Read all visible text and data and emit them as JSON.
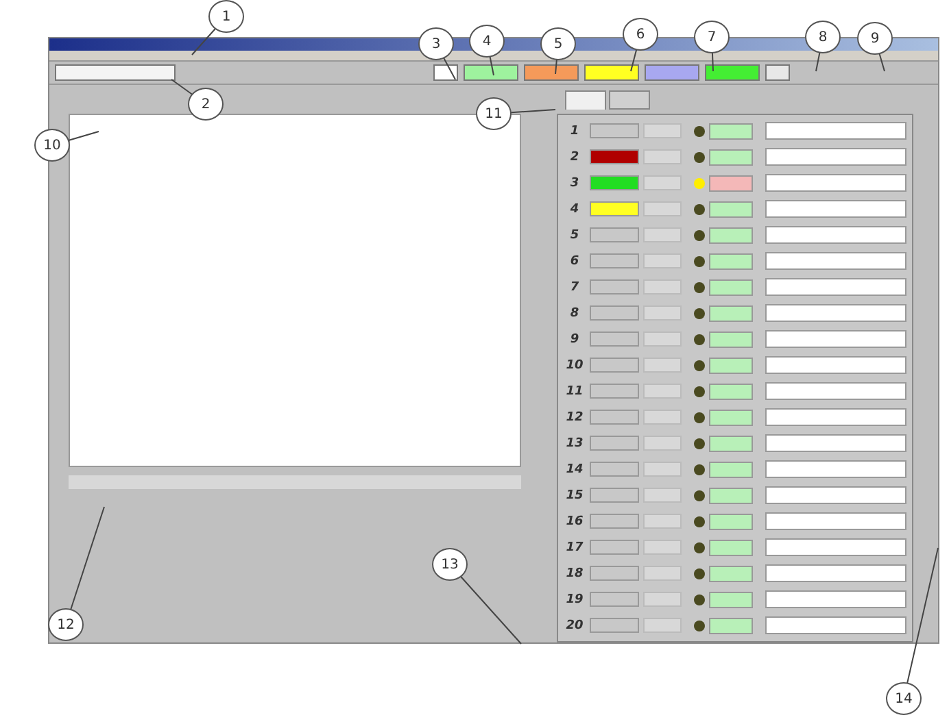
{
  "toolbar": {
    "buttons": [
      {
        "kind": "plain",
        "color": "#f4f4f4"
      },
      {
        "kind": "small",
        "color": "#ffffff"
      },
      {
        "kind": "color",
        "color": "#9ef29e"
      },
      {
        "kind": "color",
        "color": "#f59a5a"
      },
      {
        "kind": "color",
        "color": "#ffff22"
      },
      {
        "kind": "color",
        "color": "#a8a8f0"
      },
      {
        "kind": "color",
        "color": "#44ee33"
      },
      {
        "kind": "small",
        "color": "#e8e8e8"
      }
    ]
  },
  "tabs": [
    {
      "selected": true
    },
    {
      "selected": false
    }
  ],
  "channels": [
    {
      "number": "1",
      "color": "#c8c8c8",
      "active": false
    },
    {
      "number": "2",
      "color": "#b00000",
      "active": false
    },
    {
      "number": "3",
      "color": "#22dd22",
      "active": true
    },
    {
      "number": "4",
      "color": "#ffff22",
      "active": false
    },
    {
      "number": "5",
      "color": "#c8c8c8",
      "active": false
    },
    {
      "number": "6",
      "color": "#c8c8c8",
      "active": false
    },
    {
      "number": "7",
      "color": "#c8c8c8",
      "active": false
    },
    {
      "number": "8",
      "color": "#c8c8c8",
      "active": false
    },
    {
      "number": "9",
      "color": "#c8c8c8",
      "active": false
    },
    {
      "number": "10",
      "color": "#c8c8c8",
      "active": false
    },
    {
      "number": "11",
      "color": "#c8c8c8",
      "active": false
    },
    {
      "number": "12",
      "color": "#c8c8c8",
      "active": false
    },
    {
      "number": "13",
      "color": "#c8c8c8",
      "active": false
    },
    {
      "number": "14",
      "color": "#c8c8c8",
      "active": false
    },
    {
      "number": "15",
      "color": "#c8c8c8",
      "active": false
    },
    {
      "number": "16",
      "color": "#c8c8c8",
      "active": false
    },
    {
      "number": "17",
      "color": "#c8c8c8",
      "active": false
    },
    {
      "number": "18",
      "color": "#c8c8c8",
      "active": false
    },
    {
      "number": "19",
      "color": "#c8c8c8",
      "active": false
    },
    {
      "number": "20",
      "color": "#c8c8c8",
      "active": false
    }
  ],
  "callouts": [
    "1",
    "2",
    "3",
    "4",
    "5",
    "6",
    "7",
    "8",
    "9",
    "10",
    "11",
    "12",
    "13",
    "14"
  ]
}
